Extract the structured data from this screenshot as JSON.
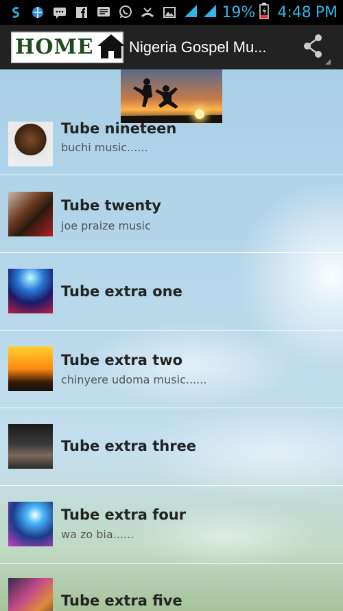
{
  "status_bar": {
    "battery": "19%",
    "time": "4:48",
    "ampm": "PM",
    "left_icons": [
      "swirl-icon",
      "globe-icon",
      "sms-icon",
      "facebook-icon",
      "message-icon",
      "whatsapp-icon",
      "missed-call-icon",
      "image-icon"
    ]
  },
  "action_bar": {
    "home_label": "HOME",
    "title": "Nigeria Gospel Mu..."
  },
  "list": [
    {
      "title": "Tube nineteen",
      "subtitle": "buchi music......"
    },
    {
      "title": "Tube twenty",
      "subtitle": "joe praize music"
    },
    {
      "title": "Tube extra one",
      "subtitle": ""
    },
    {
      "title": "Tube extra two",
      "subtitle": "chinyere udoma music......"
    },
    {
      "title": "Tube extra three",
      "subtitle": ""
    },
    {
      "title": "Tube extra four",
      "subtitle": "wa zo bia......"
    },
    {
      "title": "Tube extra five",
      "subtitle": ""
    }
  ],
  "colors": {
    "status_accent": "#33b5e5",
    "action_bar": "#222222"
  }
}
